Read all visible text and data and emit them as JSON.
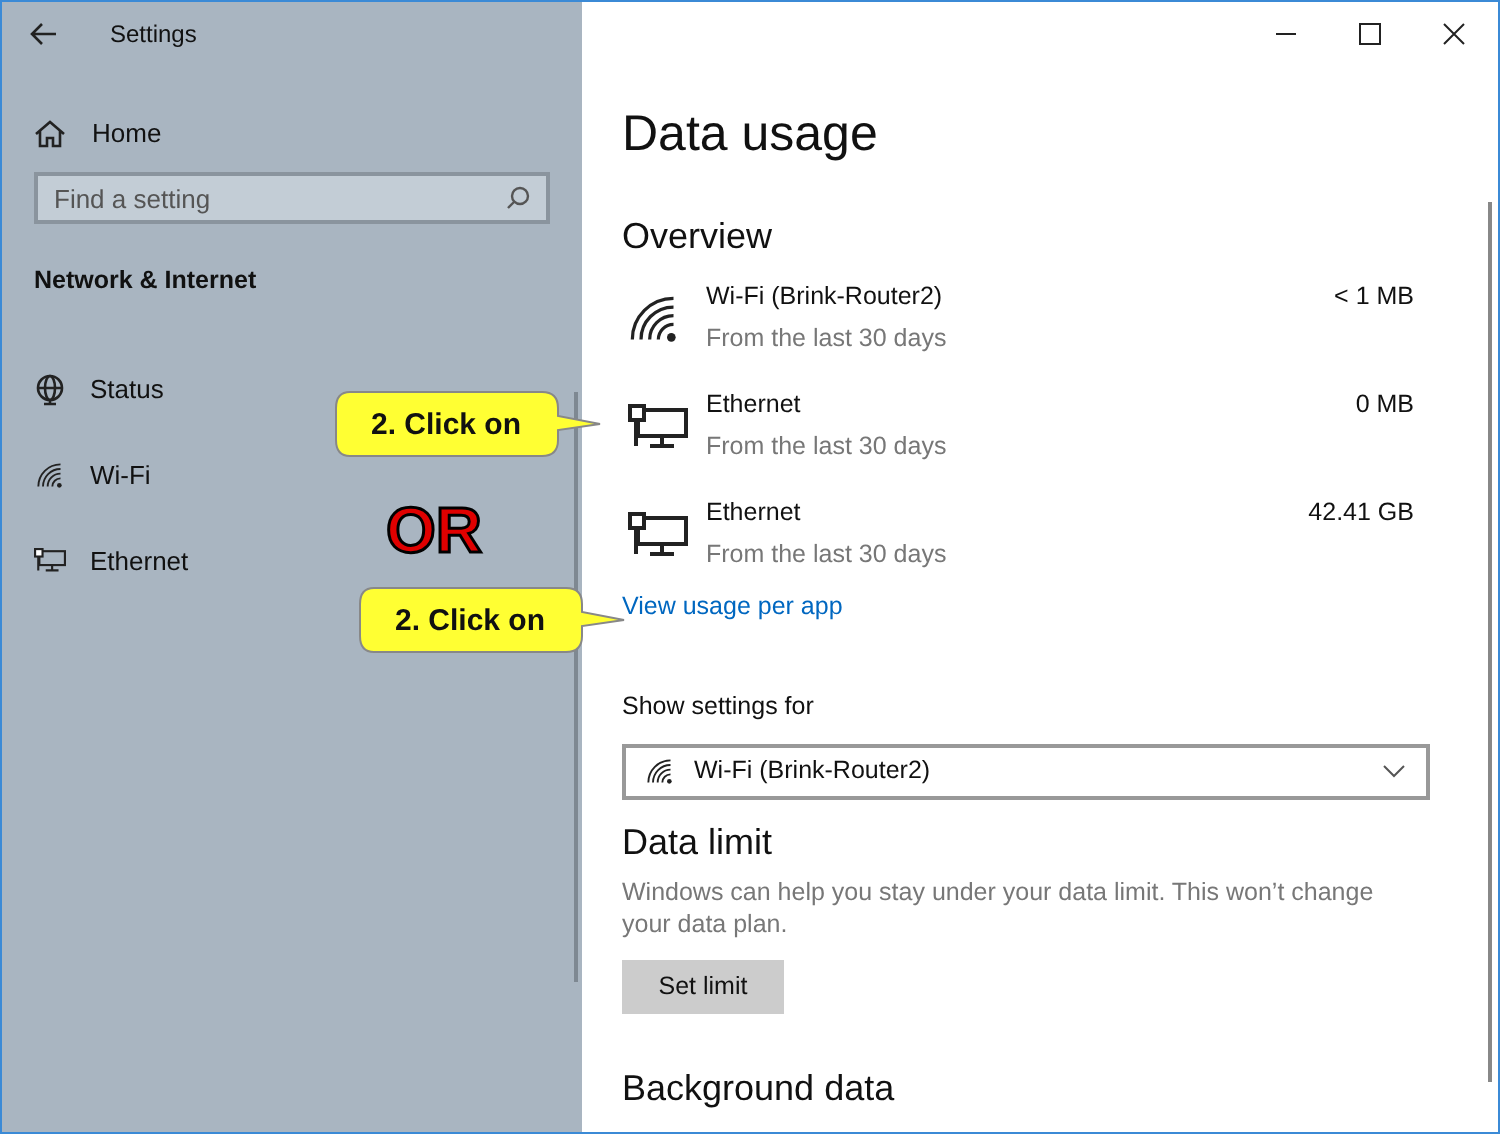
{
  "window": {
    "title": "Settings"
  },
  "sidebar": {
    "home": "Home",
    "search": {
      "placeholder": "Find a setting"
    },
    "section": "Network & Internet",
    "items": [
      {
        "label": "Status",
        "kind": "globe",
        "selected": false
      },
      {
        "label": "Wi-Fi",
        "kind": "wifi",
        "selected": false
      },
      {
        "label": "Ethernet",
        "kind": "ethernet",
        "selected": false
      }
    ]
  },
  "page": {
    "title": "Data usage",
    "overview": {
      "heading": "Overview",
      "items": [
        {
          "kind": "wifi",
          "name": "Wi-Fi (Brink-Router2)",
          "period": "From the last 30 days",
          "amount": "< 1 MB"
        },
        {
          "kind": "ethernet",
          "name": "Ethernet",
          "period": "From the last 30 days",
          "amount": "0 MB"
        },
        {
          "kind": "ethernet",
          "name": "Ethernet",
          "period": "From the last 30 days",
          "amount": "42.41 GB"
        }
      ],
      "link": "View usage per app"
    },
    "show_settings_for": {
      "label": "Show settings for",
      "value": "Wi-Fi (Brink-Router2)"
    },
    "data_limit": {
      "heading": "Data limit",
      "description": "Windows can help you stay under your data limit. This won’t change your data plan.",
      "button": "Set limit"
    },
    "background_data": {
      "heading": "Background data"
    }
  },
  "annotations": {
    "callouts": [
      "2. Click on",
      "2. Click on"
    ],
    "or": "OR"
  }
}
